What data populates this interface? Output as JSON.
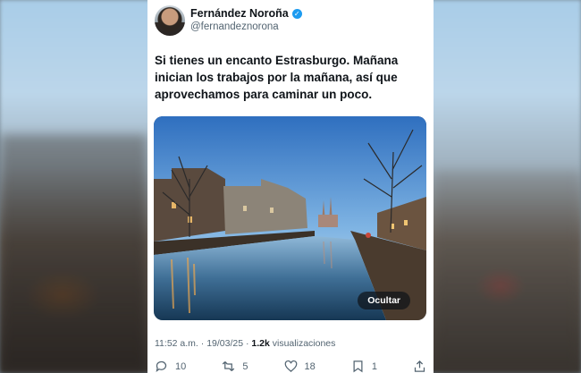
{
  "author": {
    "display_name": "Fernández Noroña",
    "handle": "@fernandeznorona",
    "verified_icon": "✓"
  },
  "tweet": {
    "text": "Si tienes un encanto Estrasburgo. Mañana\ninician los trabajos por la mañana, así que\naprovechamos para caminar un poco."
  },
  "media": {
    "hide_label": "Ocultar"
  },
  "meta": {
    "time": "11:52 a.m.",
    "separator": " · ",
    "date": "19/03/25",
    "views_count": "1.2k",
    "views_label": " visualizaciones"
  },
  "actions": {
    "replies": "10",
    "reposts": "5",
    "likes": "18",
    "bookmarks": "1"
  },
  "colors": {
    "accent": "#1d9bf0",
    "text": "#0f1419",
    "secondary": "#536471"
  }
}
